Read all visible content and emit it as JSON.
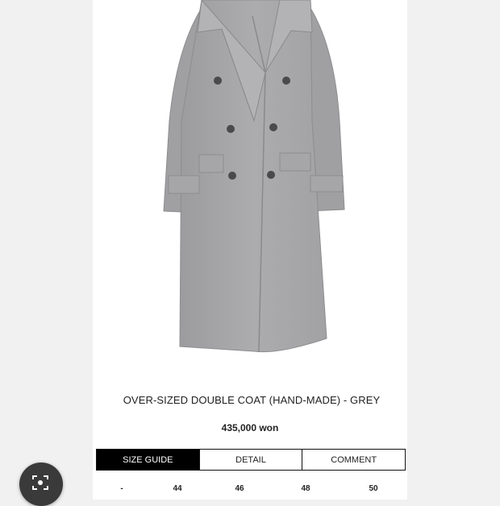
{
  "product": {
    "title": "OVER-SIZED DOUBLE COAT (HAND-MADE) - GREY",
    "price": "435,000 won",
    "image_icon": "grey-double-breasted-coat",
    "coat_color": "#a9a9ab"
  },
  "tabs": [
    {
      "label": "SIZE GUIDE",
      "active": true
    },
    {
      "label": "DETAIL",
      "active": false
    },
    {
      "label": "COMMENT",
      "active": false
    }
  ],
  "size_row": [
    "-",
    "44",
    "46",
    "48",
    "50"
  ],
  "floating_button": {
    "icon": "image-search-icon"
  }
}
